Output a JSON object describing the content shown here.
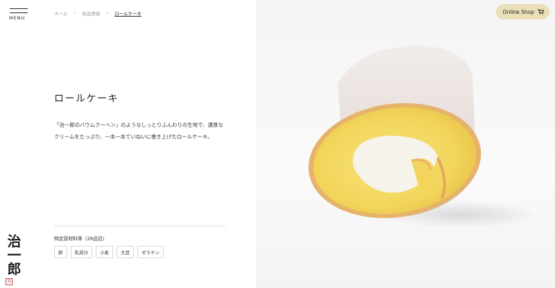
{
  "menu": {
    "label": "MENU"
  },
  "breadcrumb": {
    "items": [
      "ホーム",
      "商品情報",
      "ロールケーキ"
    ]
  },
  "header": {
    "online_shop_label": "Online Shop",
    "online_shop_icon": "cart-icon",
    "accent": "#eadfb8"
  },
  "product": {
    "title": "ロールケーキ",
    "description": "「治一郎のバウムクーヘン」のようなしっとりふんわりの生地で、濃厚なクリームをたっぷり、一本一本ていねいに巻き上げたロールケーキ。"
  },
  "allergens": {
    "heading": "特定原材料等（28品目）",
    "items": [
      "卵",
      "乳成分",
      "小麦",
      "大豆",
      "ゼラチン"
    ]
  },
  "brand": {
    "logo_text": "治一郎",
    "seal_text": "治"
  }
}
